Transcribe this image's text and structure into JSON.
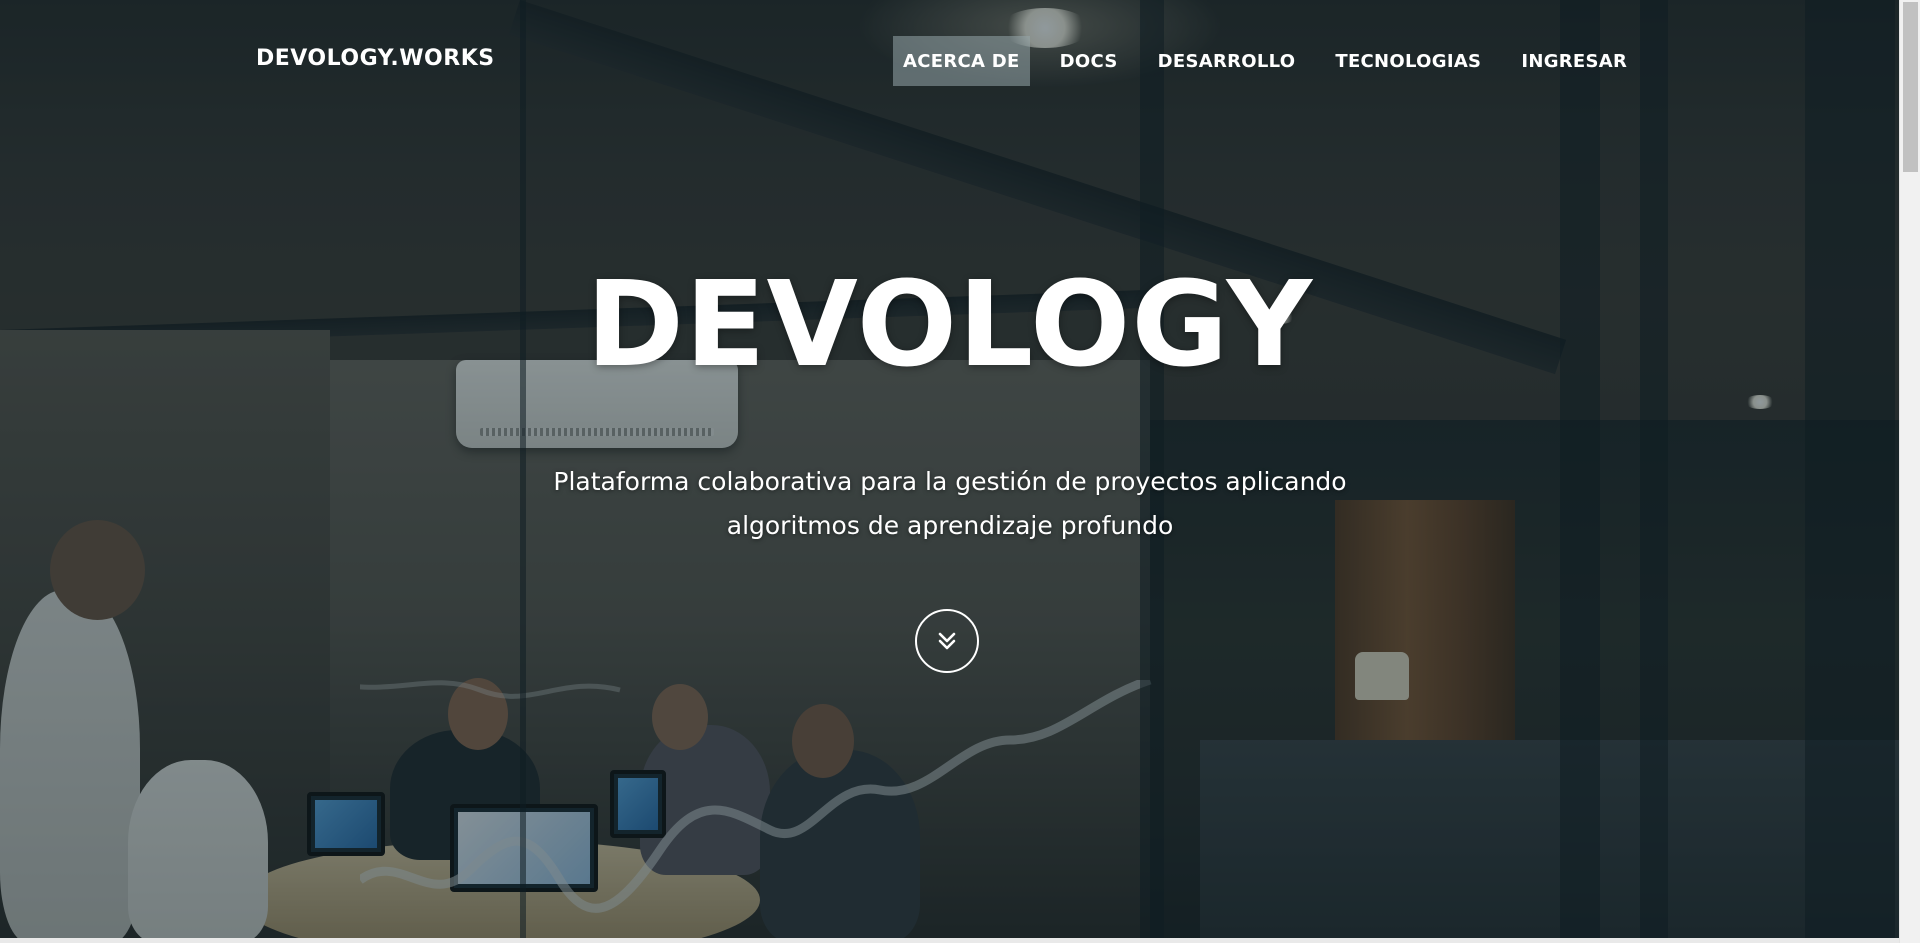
{
  "brand": {
    "name": "DEVOLOGY.WORKS"
  },
  "nav": {
    "items": [
      {
        "label": "ACERCA DE",
        "active": true
      },
      {
        "label": "DOCS",
        "active": false
      },
      {
        "label": "DESARROLLO",
        "active": false
      },
      {
        "label": "TECNOLOGIAS",
        "active": false
      },
      {
        "label": "INGRESAR",
        "active": false
      }
    ]
  },
  "hero": {
    "title": "DEVOLOGY",
    "subtitle": "Plataforma colaborativa para la gestión de proyectos aplicando algoritmos de aprendizaje profundo",
    "scroll_icon": "chevron-double-down-icon"
  },
  "theme": {
    "overlay_color": "#081c24",
    "text_color": "#ffffff",
    "active_nav_bg": "#96a5aa"
  }
}
